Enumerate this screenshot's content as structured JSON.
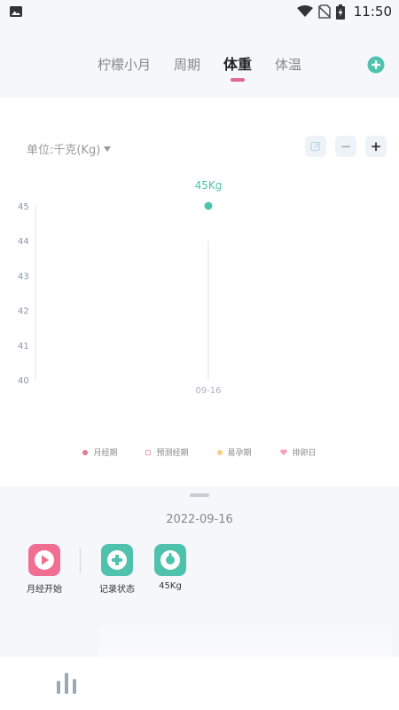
{
  "status_bar": {
    "time": "11:50"
  },
  "tabs": [
    {
      "label": "柠檬小月",
      "active": false
    },
    {
      "label": "周期",
      "active": false
    },
    {
      "label": "体重",
      "active": true
    },
    {
      "label": "体温",
      "active": false
    }
  ],
  "weight": {
    "unit_label": "单位:千克(Kg)",
    "tools": {
      "minus": "−",
      "plus": "+"
    }
  },
  "chart_data": {
    "type": "scatter",
    "y_ticks": [
      "45",
      "44",
      "43",
      "42",
      "41",
      "40"
    ],
    "ylim": [
      40,
      45
    ],
    "x_ticks": [
      "09-16"
    ],
    "points": [
      {
        "x": "09-16",
        "y": 45,
        "label": "45Kg"
      }
    ],
    "legend": [
      {
        "name": "月经期",
        "color": "#e07c8c"
      },
      {
        "name": "预测经期",
        "color": "#e8a0b0",
        "hollow": true
      },
      {
        "name": "易孕期",
        "color": "#f3cf7a"
      },
      {
        "name": "排卵日",
        "color": "#f2a0b8"
      }
    ]
  },
  "record": {
    "date": "2022-09-16",
    "actions": [
      {
        "label": "月经开始",
        "color": "#ef6e92"
      },
      {
        "label": "记录状态",
        "color": "#4fc2ad"
      },
      {
        "label": "45Kg",
        "color": "#4fc2ad"
      }
    ]
  },
  "colors": {
    "accent": "#4fc2ad",
    "tab_indicator": "#e06b8b"
  }
}
